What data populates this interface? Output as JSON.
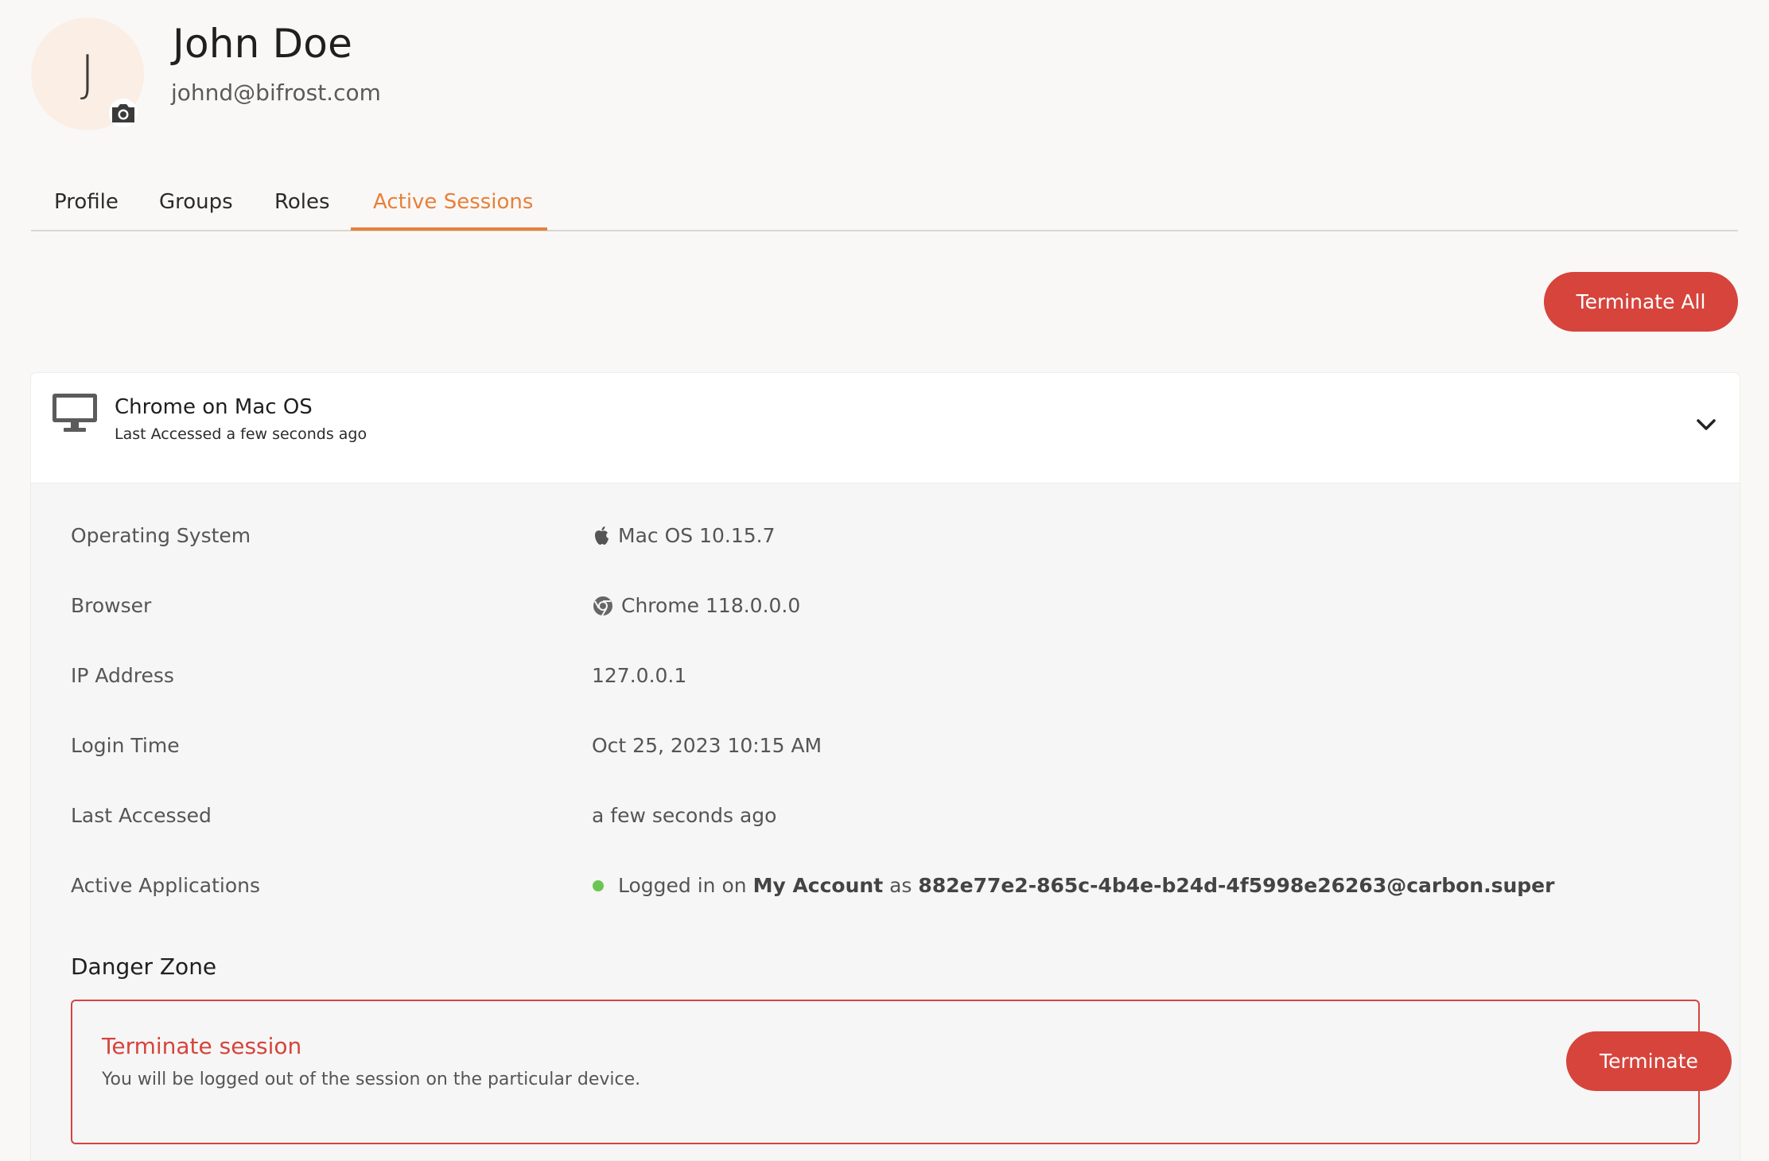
{
  "user": {
    "initial": "J",
    "name": "John Doe",
    "email": "johnd@bifrost.com"
  },
  "tabs": [
    {
      "label": "Profile"
    },
    {
      "label": "Groups"
    },
    {
      "label": "Roles"
    },
    {
      "label": "Active Sessions",
      "active": true
    }
  ],
  "actions": {
    "terminate_all": "Terminate All"
  },
  "session": {
    "title": "Chrome on Mac OS",
    "subtitle": "Last Accessed a few seconds ago",
    "details": {
      "os_label": "Operating System",
      "os_value": "Mac OS 10.15.7",
      "browser_label": "Browser",
      "browser_value": "Chrome 118.0.0.0",
      "ip_label": "IP Address",
      "ip_value": "127.0.0.1",
      "login_label": "Login Time",
      "login_value": "Oct 25, 2023 10:15 AM",
      "last_label": "Last Accessed",
      "last_value": "a few seconds ago",
      "apps_label": "Active Applications",
      "apps_prefix": "Logged in on",
      "apps_app": "My Account",
      "apps_as": "as",
      "apps_user": "882e77e2-865c-4b4e-b24d-4f5998e26263@carbon.super"
    },
    "danger_zone": {
      "heading": "Danger Zone",
      "title": "Terminate session",
      "description": "You will be logged out of the session on the particular device.",
      "button": "Terminate"
    }
  },
  "colors": {
    "accent": "#e7803a",
    "danger": "#d6443c",
    "active_dot": "#6cc552",
    "background": "#faf8f6"
  },
  "icons": [
    "camera-icon",
    "monitor-icon",
    "chevron-down-icon",
    "apple-icon",
    "chrome-icon",
    "status-dot"
  ]
}
